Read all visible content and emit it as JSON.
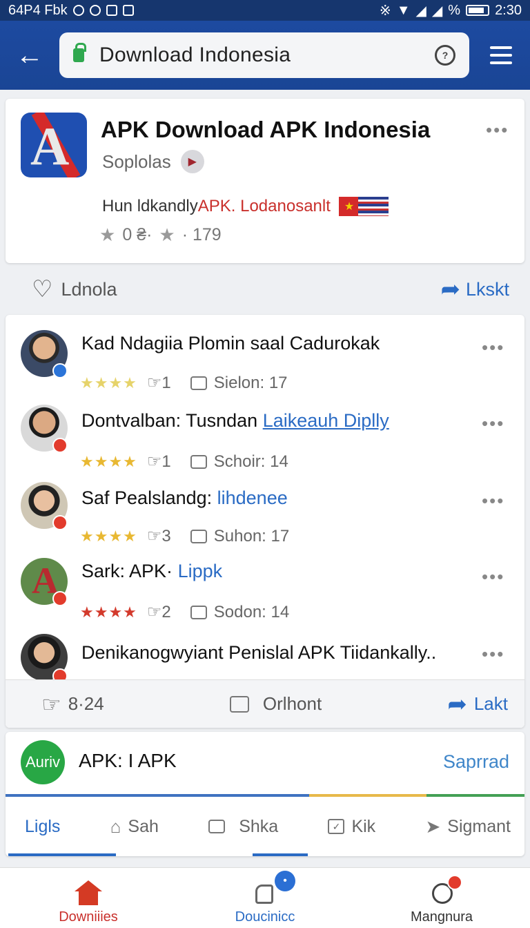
{
  "status_bar": {
    "left_text": "64P4 Fbk",
    "time": "2:30",
    "percent_sign": "%"
  },
  "app_bar": {
    "url_text": "Download Indonesia"
  },
  "app_card": {
    "title": "APK Download APK  Indonesia",
    "developer": "Soplolas",
    "tagline_dark": "Hun ldkandly ",
    "tagline_red": "APK. Lodanosanlt",
    "stat_1": "0 ₴·",
    "stat_2": "· 179"
  },
  "action_row": {
    "like_label": "Ldnola",
    "share_label": "Lkskt"
  },
  "reviews": [
    {
      "title": "Kad Ndagiia Plomin saal Cadurokak",
      "link": "",
      "stars": "★★★★",
      "likes": "1",
      "comment": "Sielon: 17"
    },
    {
      "title": "Dontvalban: Tusndan ",
      "link": "Laikeauh Diplly",
      "stars": "★★★★",
      "likes": "1",
      "comment": "Schoir: 14"
    },
    {
      "title": "Saf Pealslandg: ",
      "link": "lihdenee",
      "stars": "★★★★",
      "likes": "3",
      "comment": "Suhon: 17"
    },
    {
      "title": "Sark: APK· ",
      "link": "Lippk",
      "stars": "★★★★",
      "likes": "2",
      "comment": "Sodon: 14"
    },
    {
      "title": "Denikanogwyiant Penislal APK Tiidankally..",
      "link": "",
      "stars": "",
      "likes": "",
      "comment": ""
    }
  ],
  "reviews_footer": {
    "likes": "8·24",
    "comment_label": "Orlhont",
    "share_label": "Lakt"
  },
  "bottom_card": {
    "avatar_text": "Auriv",
    "title": "APK: I APK",
    "action": "Saprrad",
    "tabs": [
      "Ligls",
      "Sah",
      "Shka",
      "Kik",
      "Sigmant"
    ]
  },
  "bottom_nav": {
    "items": [
      "Downiiies",
      "Doucinicc",
      "Mangnura"
    ]
  },
  "colors": {
    "app_bar": "#1d4aa0",
    "accent_blue": "#2a6bc4",
    "accent_red": "#c9302c",
    "star_gold": "#e8b832"
  }
}
